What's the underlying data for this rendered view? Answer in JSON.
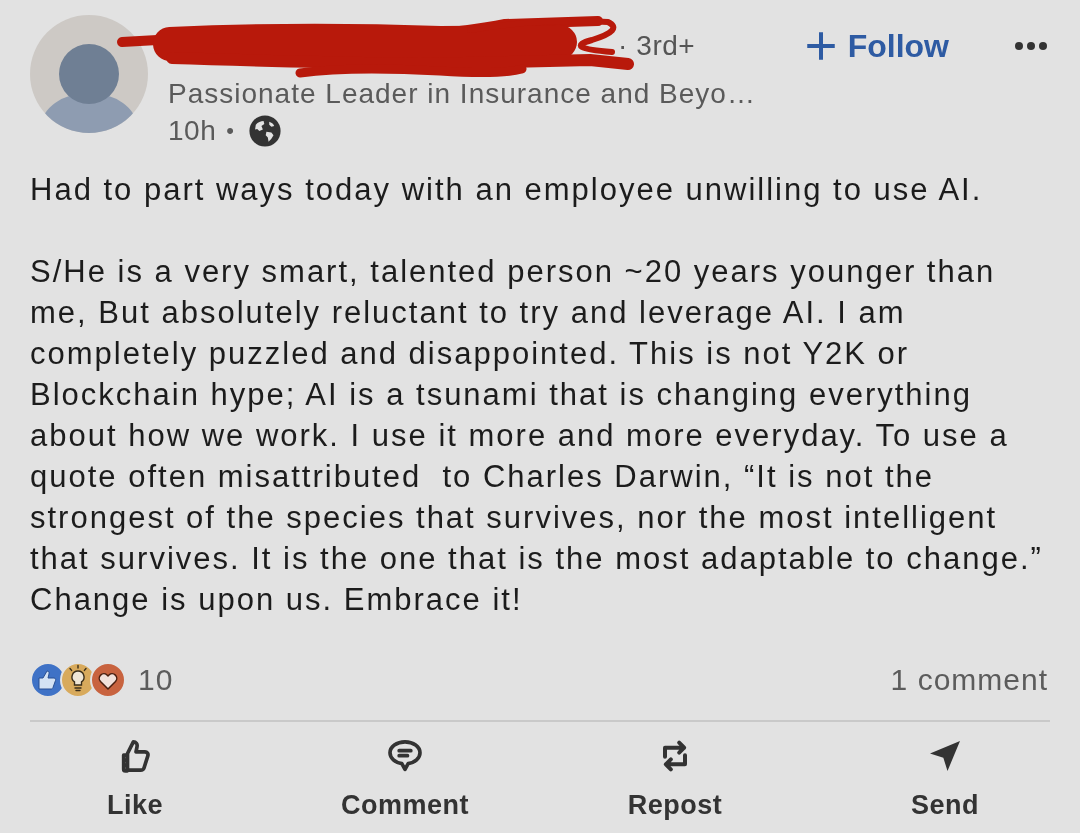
{
  "post": {
    "author": {
      "name_redacted": true,
      "connection_separator": "·",
      "connection": "3rd+",
      "headline": "Passionate Leader in Insurance and Beyo…",
      "time": "10h",
      "time_separator": "•",
      "public": true
    },
    "follow_button": {
      "label": "Follow"
    },
    "body": [
      "Had to part ways today with an employee unwilling to use AI.",
      "S/He is a very smart, talented person ~20 years younger than me, But absolutely reluctant to try and leverage AI. I am completely puzzled and disappointed. This is not Y2K or Blockchain hype; AI is a tsunami that is changing everything about how we work. I use it more and more everyday. To use a quote often misattributed  to Charles Darwin, “It is not the strongest of the species that survives, nor the most intelligent that survives. It is the one that is the most adaptable to change.” Change is upon us. Embrace it!"
    ],
    "reactions": [
      {
        "kind": "like"
      },
      {
        "kind": "insight"
      },
      {
        "kind": "love"
      }
    ],
    "reaction_count": "10",
    "comment_count": "1 comment",
    "actions": [
      {
        "kind": "like",
        "label": "Like"
      },
      {
        "kind": "comment",
        "label": "Comment"
      },
      {
        "kind": "repost",
        "label": "Repost"
      },
      {
        "kind": "send",
        "label": "Send"
      }
    ]
  }
}
